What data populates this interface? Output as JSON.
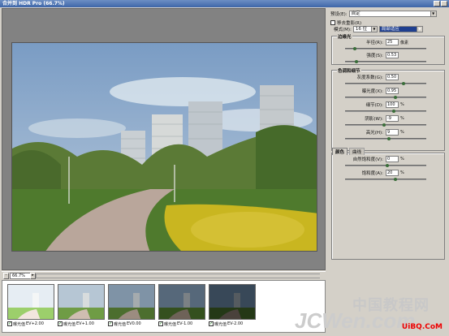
{
  "window": {
    "title": "合并到 HDR Pro (66.7%)"
  },
  "canvas": {
    "zoom": "66.7%"
  },
  "thumbnails": [
    {
      "label": "曝光值",
      "ev": "EV+2.00"
    },
    {
      "label": "曝光值",
      "ev": "EV+1.00"
    },
    {
      "label": "曝光值",
      "ev": "EV0.00"
    },
    {
      "label": "曝光值",
      "ev": "EV-1.00"
    },
    {
      "label": "曝光值",
      "ev": "EV-2.00"
    }
  ],
  "panel": {
    "preset_label": "预设(E):",
    "preset_value": "自定",
    "remove_ghosts": "移去重影(R)",
    "mode_label": "模式(M):",
    "mode_bits": "16 位",
    "mode_method": "局部适应",
    "edge_glow": {
      "title": "边缘光",
      "radius_label": "半径(R):",
      "radius_value": "25",
      "radius_unit": "像素",
      "strength_label": "强度(S):",
      "strength_value": "0.53"
    },
    "tone_detail": {
      "title": "色调和细节",
      "gamma_label": "灰度系数(G):",
      "gamma_value": "0.50",
      "exposure_label": "曝光度(X):",
      "exposure_value": "0.95",
      "detail_label": "细节(D):",
      "detail_value": "100",
      "detail_unit": "%",
      "shadow_label": "阴影(W):",
      "shadow_value": "-9",
      "shadow_unit": "%",
      "highlight_label": "高光(H):",
      "highlight_value": "9",
      "highlight_unit": "%"
    },
    "color": {
      "tab_color": "颜色",
      "tab_curve": "曲线",
      "vibrance_label": "自然饱和度(V):",
      "vibrance_value": "0",
      "vibrance_unit": "%",
      "saturation_label": "饱和度(A):",
      "saturation_value": "20",
      "saturation_unit": "%"
    }
  },
  "watermark": {
    "line1": "中国教程网",
    "line2": "JCWen.com",
    "line3": "UiBQ.CoM"
  }
}
